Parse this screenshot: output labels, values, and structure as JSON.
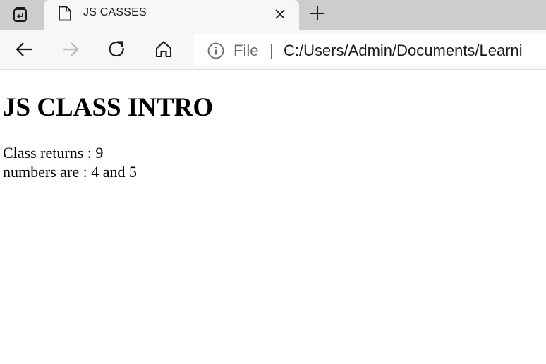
{
  "browser": {
    "tab": {
      "title": "JS CASSES",
      "favicon": "page-icon"
    },
    "icons": {
      "tab_actions": "tab-actions-icon",
      "close": "close-icon",
      "new_tab": "plus-icon",
      "back": "arrow-left-icon",
      "forward": "arrow-right-icon",
      "refresh": "refresh-icon",
      "home": "home-icon",
      "site_info": "info-icon"
    },
    "address_bar": {
      "scheme_label": "File",
      "separator": "|",
      "url": "C:/Users/Admin/Documents/Learni"
    },
    "colors": {
      "tabstrip_bg": "#cdcdcd",
      "toolbar_bg": "#f7f7f7",
      "disabled_icon": "#b8b8b8"
    }
  },
  "page": {
    "heading": "JS CLASS INTRO",
    "lines": [
      "Class returns : 9",
      "numbers are : 4 and 5"
    ]
  }
}
